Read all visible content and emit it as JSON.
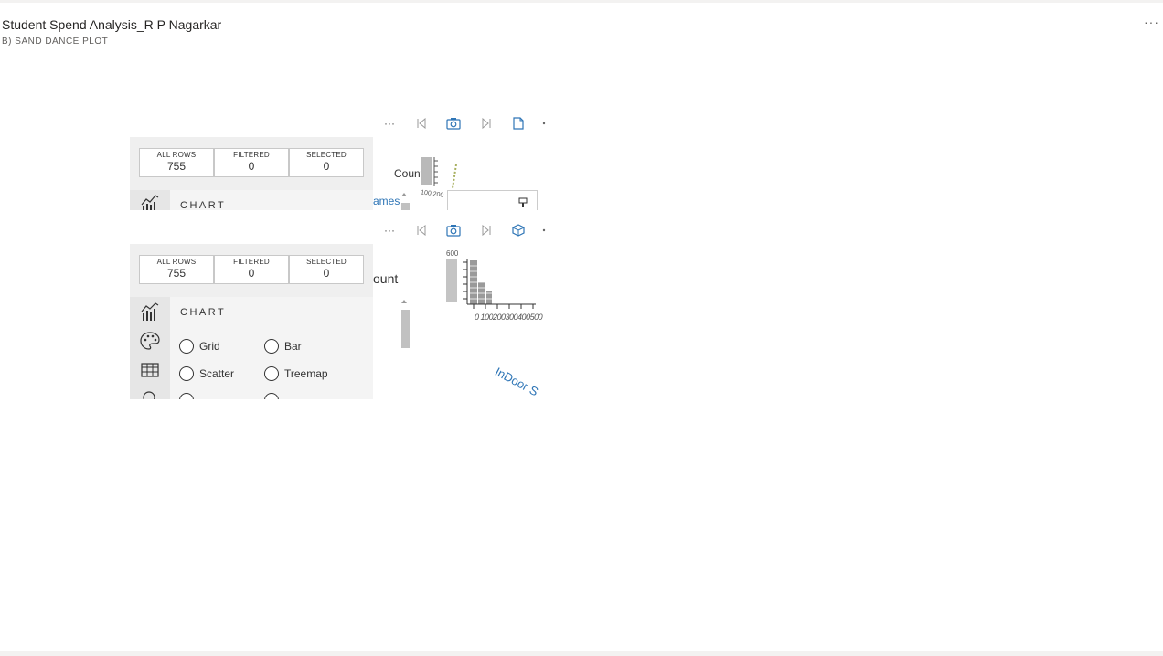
{
  "report": {
    "title": "Student Spend Analysis_R P Nagarkar",
    "subtitle": "B) SAND DANCE PLOT",
    "more": "···"
  },
  "panels": [
    {
      "toolbar_more": "···",
      "stats": [
        {
          "label": "ALL ROWS",
          "value": "755"
        },
        {
          "label": "FILTERED",
          "value": "0"
        },
        {
          "label": "SELECTED",
          "value": "0"
        }
      ],
      "chart_heading": "CHART",
      "canvas": {
        "count_label": "Count",
        "partial_label": "ames",
        "axis_hint": "100 200"
      }
    },
    {
      "toolbar_more": "···",
      "stats": [
        {
          "label": "ALL ROWS",
          "value": "755"
        },
        {
          "label": "FILTERED",
          "value": "0"
        },
        {
          "label": "SELECTED",
          "value": "0"
        }
      ],
      "chart_heading": "CHART",
      "chart_types": [
        "Grid",
        "Bar",
        "Scatter",
        "Treemap"
      ],
      "canvas": {
        "count_label": "ount",
        "y_tick_top": "600",
        "x_ticks": "0 100200300400500",
        "rotated_label": "InDoor S"
      }
    }
  ],
  "colors": {
    "accent": "#2e75b6",
    "stats_bg": "#efefef",
    "iconcol_bg": "#e6e6e6",
    "sidebar_bg": "#f4f4f4"
  }
}
